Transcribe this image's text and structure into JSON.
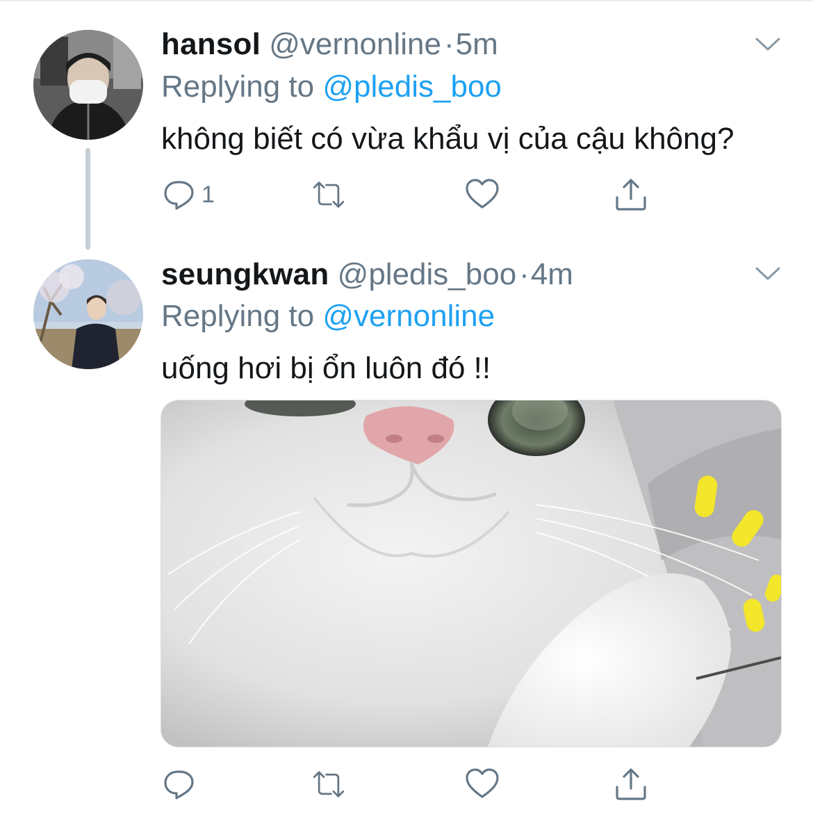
{
  "tweets": [
    {
      "name": "hansol",
      "handle": "@vernonline",
      "separator": "·",
      "time": "5m",
      "replying_prefix": "Replying to",
      "replying_to": "@pledis_boo",
      "text": "không biết có vừa khẩu vị của cậu không?",
      "reply_count": "1"
    },
    {
      "name": "seungkwan",
      "handle": "@pledis_boo",
      "separator": "·",
      "time": "4m",
      "replying_prefix": "Replying to",
      "replying_to": "@vernonline",
      "text": "uống hơi bị ổn luôn đó !!",
      "reply_count": ""
    }
  ],
  "icons": {
    "reply": "reply-icon",
    "retweet": "retweet-icon",
    "like": "heart-icon",
    "share": "share-icon",
    "more": "chevron-down-icon"
  },
  "colors": {
    "link": "#1da1f2",
    "secondary_text": "#657786",
    "primary_text": "#14171a",
    "thread_line": "#c4cfd6"
  }
}
